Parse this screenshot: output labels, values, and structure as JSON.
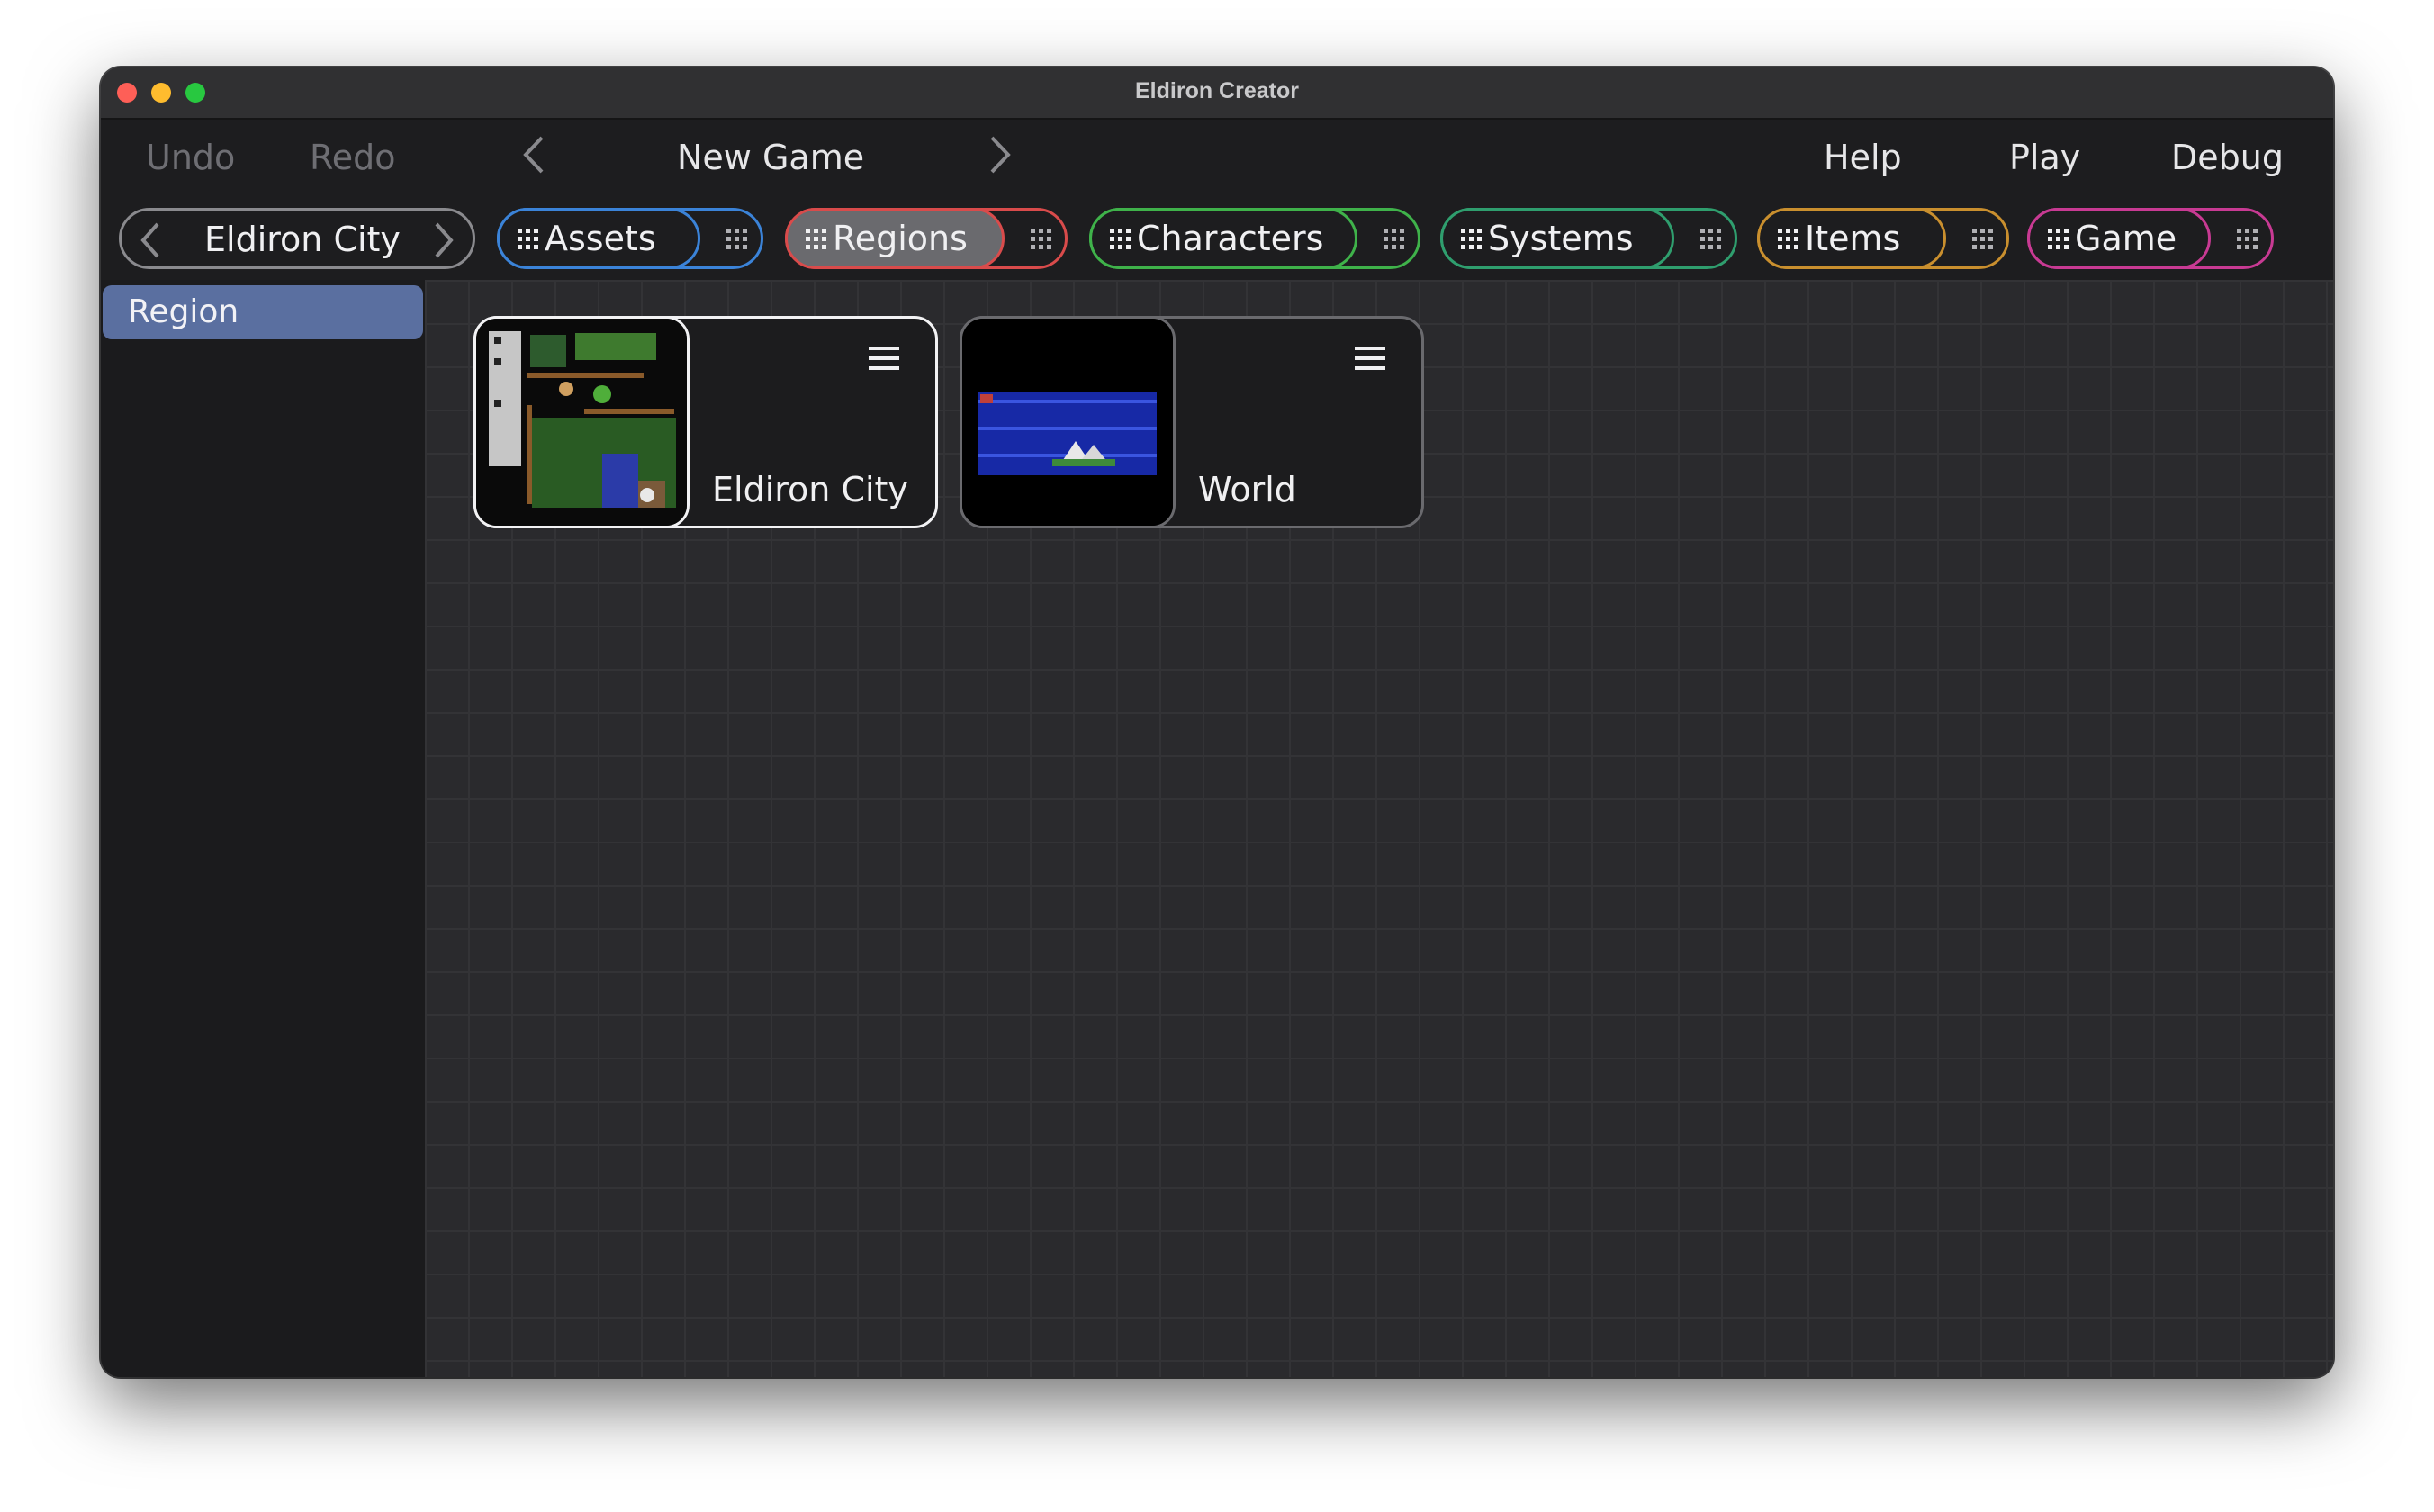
{
  "window": {
    "title": "Eldiron Creator"
  },
  "menubar": {
    "undo": "Undo",
    "redo": "Redo",
    "project": "New Game",
    "help": "Help",
    "play": "Play",
    "debug": "Debug"
  },
  "region_nav": {
    "current": "Eldiron City"
  },
  "tabs": [
    {
      "label": "Assets",
      "color": "#3b83d8"
    },
    {
      "label": "Regions",
      "color": "#d94b4b",
      "active": true
    },
    {
      "label": "Characters",
      "color": "#3fb24a"
    },
    {
      "label": "Systems",
      "color": "#2f9e6e"
    },
    {
      "label": "Items",
      "color": "#c98f2e"
    },
    {
      "label": "Game",
      "color": "#c83a93"
    }
  ],
  "sidebar": {
    "items": [
      {
        "label": "Region",
        "selected": true
      }
    ]
  },
  "regions": [
    {
      "label": "Eldiron City",
      "selected": true
    },
    {
      "label": "World",
      "selected": false
    }
  ]
}
